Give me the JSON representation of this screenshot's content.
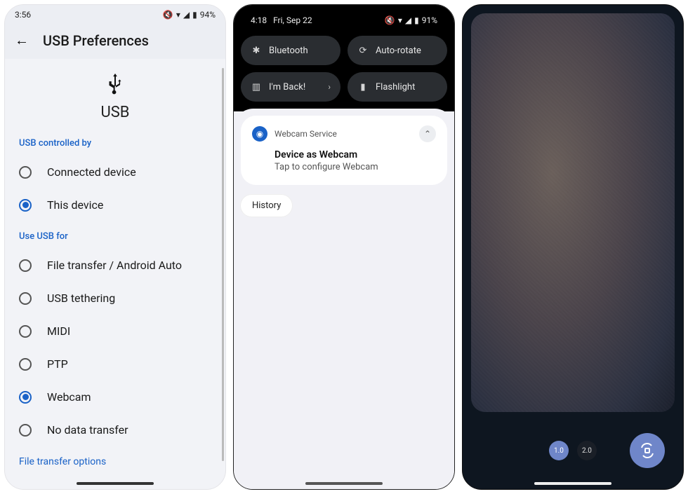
{
  "phone1": {
    "status": {
      "time": "3:56",
      "battery": "94%"
    },
    "title": "USB Preferences",
    "usb_heading": "USB",
    "section_controlled": "USB controlled by",
    "controlled_options": [
      {
        "label": "Connected device",
        "selected": false
      },
      {
        "label": "This device",
        "selected": true
      }
    ],
    "section_usefor": "Use USB for",
    "usefor_options": [
      {
        "label": "File transfer / Android Auto",
        "selected": false
      },
      {
        "label": "USB tethering",
        "selected": false
      },
      {
        "label": "MIDI",
        "selected": false
      },
      {
        "label": "PTP",
        "selected": false
      },
      {
        "label": "Webcam",
        "selected": true
      },
      {
        "label": "No data transfer",
        "selected": false
      }
    ],
    "footer_link": "File transfer options"
  },
  "phone2": {
    "status": {
      "time": "4:18",
      "date": "Fri, Sep 22",
      "battery": "91%"
    },
    "tiles": [
      {
        "icon": "bluetooth",
        "label": "Bluetooth"
      },
      {
        "icon": "rotate",
        "label": "Auto-rotate"
      },
      {
        "icon": "device",
        "label": "I'm Back!",
        "chevron": true
      },
      {
        "icon": "flashlight",
        "label": "Flashlight"
      }
    ],
    "notification": {
      "app": "Webcam Service",
      "title": "Device as Webcam",
      "body": "Tap to configure Webcam"
    },
    "history_chip": "History"
  },
  "phone3": {
    "zoom_levels": [
      {
        "label": "1.0",
        "active": true
      },
      {
        "label": "2.0",
        "active": false
      }
    ]
  }
}
